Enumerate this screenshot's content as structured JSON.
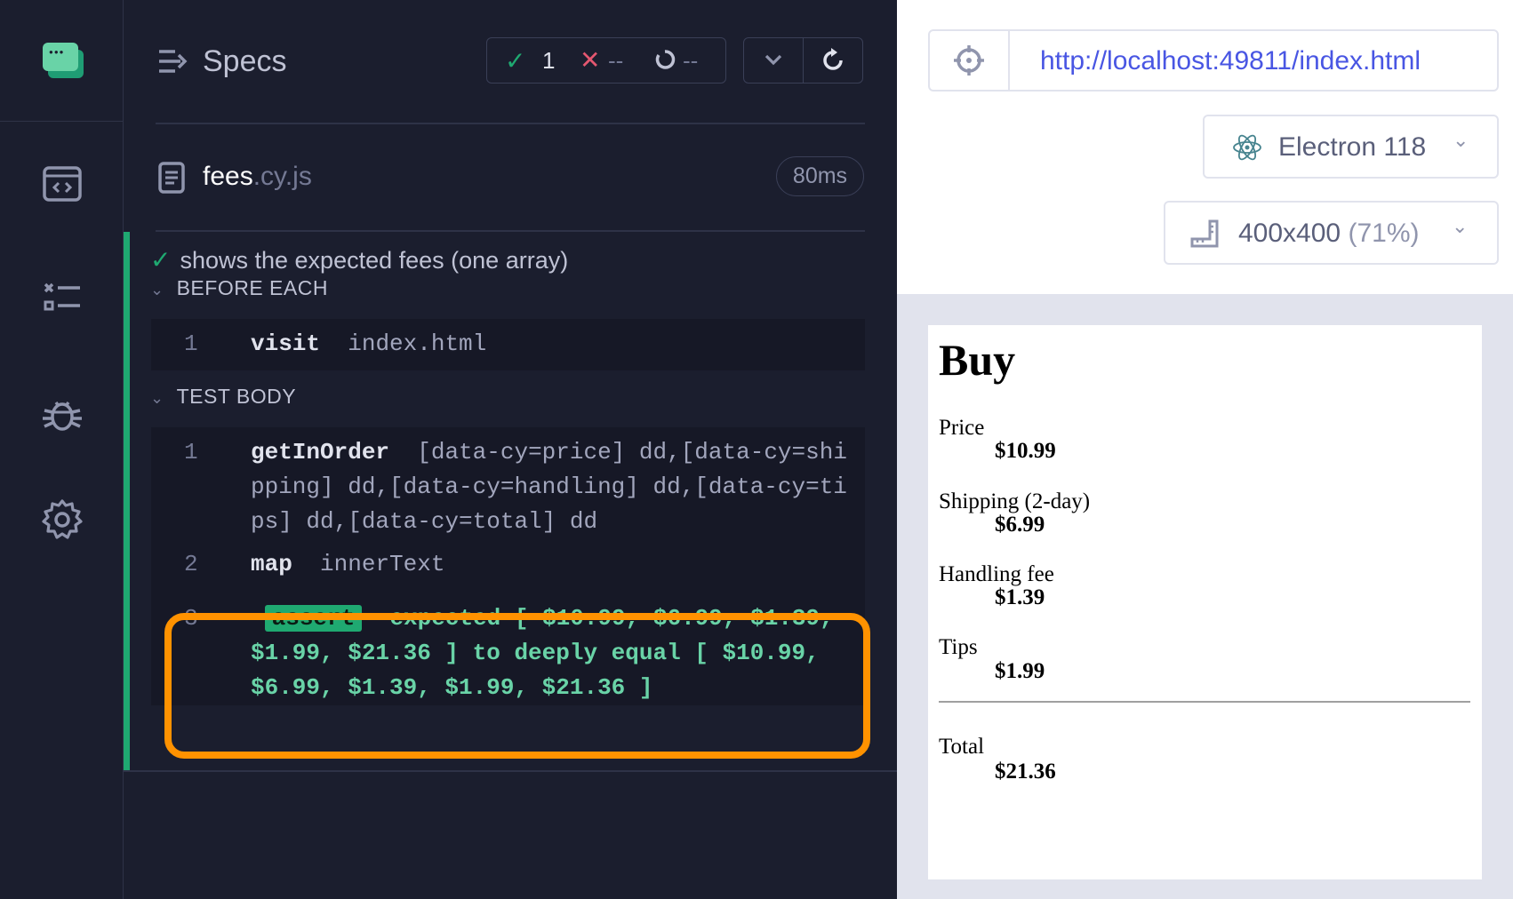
{
  "reporter": {
    "title": "Specs",
    "stats": {
      "passed": "1",
      "failed": "--",
      "pending": "--"
    },
    "file": {
      "name": "fees",
      "ext": ".cy.js",
      "duration": "80ms"
    },
    "test": {
      "title": "shows the expected fees (one array)",
      "before_each": {
        "label": "BEFORE EACH",
        "commands": [
          {
            "num": "1",
            "name": "visit",
            "arg": "index.html"
          }
        ]
      },
      "body": {
        "label": "TEST BODY",
        "commands": [
          {
            "num": "1",
            "name": "getInOrder",
            "arg": "[data-cy=price] dd,[data-cy=shipping] dd,[data-cy=handling] dd,[data-cy=tips] dd,[data-cy=total] dd"
          },
          {
            "num": "2",
            "name": "map",
            "arg": "innerText"
          },
          {
            "num": "3",
            "prefix": "-",
            "name": "assert",
            "message": "expected [ $10.99, $6.99, $1.39, $1.99, $21.36 ] to deeply equal [ $10.99, $6.99, $1.39, $1.99, $21.36 ]"
          }
        ]
      }
    }
  },
  "aut_header": {
    "url": "http://localhost:49811/index.html",
    "browser": "Electron 118",
    "viewport": "400x400",
    "viewport_scale": "(71%)"
  },
  "app": {
    "heading": "Buy",
    "fees": [
      {
        "label": "Price",
        "value": "$10.99"
      },
      {
        "label": "Shipping (2-day)",
        "value": "$6.99"
      },
      {
        "label": "Handling fee",
        "value": "$1.39"
      },
      {
        "label": "Tips",
        "value": "$1.99"
      }
    ],
    "total": {
      "label": "Total",
      "value": "$21.36"
    }
  },
  "colors": {
    "pass": "#1fa971",
    "fail": "#e45770",
    "highlight": "#ff9200",
    "url": "#4956e3"
  },
  "icons": [
    "cypress-logo-icon",
    "specs-icon",
    "runs-icon",
    "debug-icon",
    "settings-icon",
    "specs-list-icon",
    "check-icon",
    "x-icon",
    "pending-icon",
    "chevron-down-icon",
    "refresh-icon",
    "file-icon",
    "target-icon",
    "electron-icon",
    "ruler-icon"
  ]
}
